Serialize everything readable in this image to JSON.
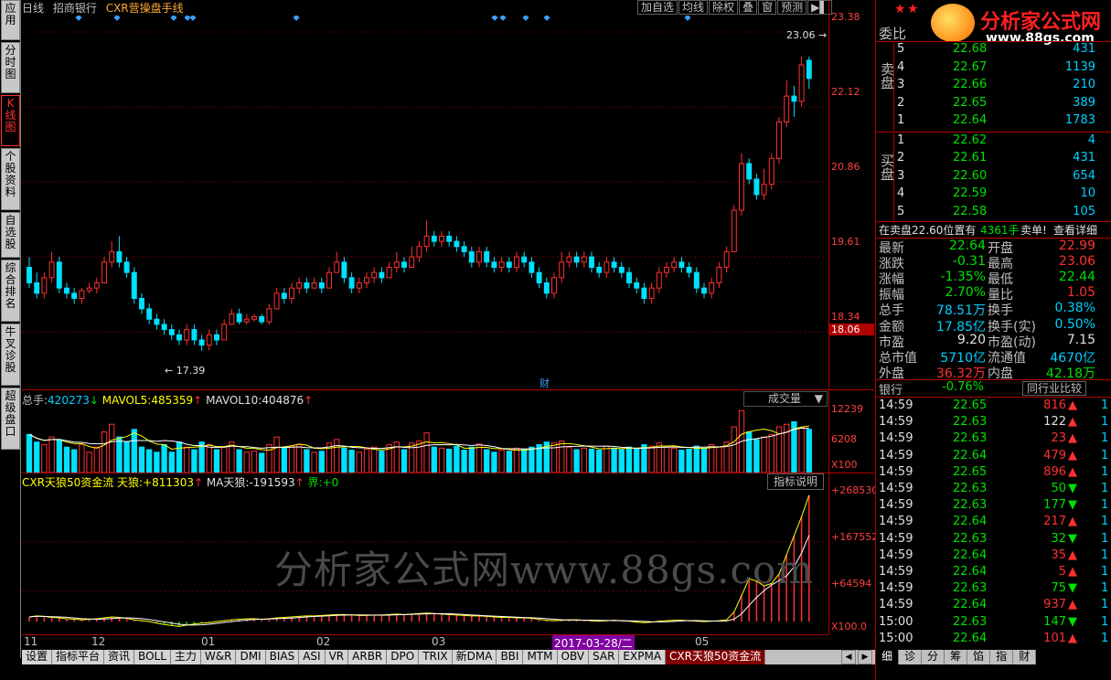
{
  "left_tabs": [
    {
      "label": "应用",
      "active": false
    },
    {
      "label": "分时图",
      "active": false
    },
    {
      "label": "K线图",
      "active": true
    },
    {
      "label": "个股资料",
      "active": false
    },
    {
      "label": "自选股",
      "active": false
    },
    {
      "label": "综合排名",
      "active": false
    },
    {
      "label": "牛叉诊股",
      "active": false
    },
    {
      "label": "超级盘口",
      "active": false
    }
  ],
  "header": {
    "period": "日线",
    "stock": "招商银行",
    "formula": "CXR营操盘手线"
  },
  "top_toolbar": [
    "加自选",
    "均线",
    "除权",
    "叠",
    "窗",
    "预测",
    "▶▌"
  ],
  "price_axis": {
    "labels": [
      "23.38",
      "22.12",
      "20.86",
      "19.61",
      "18.34"
    ],
    "current": "18.06"
  },
  "price_annotations": {
    "high": "23.06",
    "low": "17.39",
    "cai": "财"
  },
  "volume_panel": {
    "title": "总手:",
    "total": "420273",
    "total_arrow": "↓",
    "ma5_label": "MAVOL5:",
    "ma5": "485359",
    "ma5_arrow": "↑",
    "ma10_label": "MAVOL10:",
    "ma10": "404876",
    "ma10_arrow": "↑",
    "select": "成交量",
    "axis": [
      "12239",
      "6208",
      "X100"
    ]
  },
  "indicator_panel": {
    "name": "CXR天狼50资金流",
    "tl_label": "天狼:",
    "tl_value": "+811303",
    "tl_arrow": "↑",
    "ma_label": "MA天狼:",
    "ma_value": "-191593",
    "ma_arrow": "↑",
    "jie_label": "界:",
    "jie_value": "+0",
    "button": "指标说明",
    "axis": [
      "+268530",
      "+167552",
      "+64594",
      "X100.0"
    ]
  },
  "watermark": "分析家公式网www.88gs.com",
  "date_axis": [
    {
      "label": "11"
    },
    {
      "label": "12"
    },
    {
      "label": "01"
    },
    {
      "label": "02"
    },
    {
      "label": "03"
    },
    {
      "label": "2017-03-28/二",
      "highlight": true
    },
    {
      "label": "05"
    }
  ],
  "bottom_tabs": [
    "设置",
    "指标平台",
    "资讯",
    "BOLL",
    "主力",
    "W&R",
    "DMI",
    "BIAS",
    "ASI",
    "VR",
    "ARBR",
    "DPO",
    "TRIX",
    "新DMA",
    "BBI",
    "MTM",
    "OBV",
    "SAR",
    "EXPMA",
    "CXR天狼50资金流"
  ],
  "bottom_active": "CXR天狼50资金流",
  "logo": {
    "text": "分析家公式网",
    "url": "www.88gs.com"
  },
  "orderbook": {
    "title": "委比",
    "sell_side": "卖盘",
    "buy_side": "买盘",
    "asks": [
      {
        "lvl": "5",
        "price": "22.68",
        "vol": "431"
      },
      {
        "lvl": "4",
        "price": "22.67",
        "vol": "1139"
      },
      {
        "lvl": "3",
        "price": "22.66",
        "vol": "210"
      },
      {
        "lvl": "2",
        "price": "22.65",
        "vol": "389"
      },
      {
        "lvl": "1",
        "price": "22.64",
        "vol": "1783"
      }
    ],
    "bids": [
      {
        "lvl": "1",
        "price": "22.62",
        "vol": "4"
      },
      {
        "lvl": "2",
        "price": "22.61",
        "vol": "431"
      },
      {
        "lvl": "3",
        "price": "22.60",
        "vol": "654"
      },
      {
        "lvl": "4",
        "price": "22.59",
        "vol": "10"
      },
      {
        "lvl": "5",
        "price": "22.58",
        "vol": "105"
      }
    ],
    "note": "在卖盘22.60位置有",
    "note_vol": "4361手",
    "note_action": "卖单!",
    "note_link": "查看详细"
  },
  "quote": [
    {
      "l1": "最新",
      "v1": "22.64",
      "c1": "green",
      "l2": "开盘",
      "v2": "22.99",
      "c2": "red"
    },
    {
      "l1": "涨跌",
      "v1": "-0.31",
      "c1": "green",
      "l2": "最高",
      "v2": "23.06",
      "c2": "red"
    },
    {
      "l1": "涨幅",
      "v1": "-1.35%",
      "c1": "green",
      "l2": "最低",
      "v2": "22.44",
      "c2": "green"
    },
    {
      "l1": "振幅",
      "v1": "2.70%",
      "c1": "green",
      "l2": "量比",
      "v2": "1.05",
      "c2": "red"
    },
    {
      "l1": "总手",
      "v1": "78.51万",
      "c1": "cyan",
      "l2": "换手",
      "v2": "0.38%",
      "c2": "cyan"
    },
    {
      "l1": "金额",
      "v1": "17.85亿",
      "c1": "cyan",
      "l2": "换手(实)",
      "v2": "0.50%",
      "c2": "cyan"
    },
    {
      "l1": "市盈",
      "v1": "9.20",
      "c1": "white",
      "l2": "市盈(动)",
      "v2": "7.15",
      "c2": "white"
    },
    {
      "l1": "总市值",
      "v1": "5710亿",
      "c1": "cyan",
      "l2": "流通值",
      "v2": "4670亿",
      "c2": "cyan"
    },
    {
      "l1": "外盘",
      "v1": "36.32万",
      "c1": "red",
      "l2": "内盘",
      "v2": "42.18万",
      "c2": "green"
    }
  ],
  "sector": {
    "name": "银行",
    "change": "-0.76%",
    "button": "同行业比较"
  },
  "ticks": [
    {
      "t": "14:59",
      "p": "22.65",
      "v": "816",
      "d": "up",
      "pc": "green",
      "vc": "red",
      "n": "1"
    },
    {
      "t": "14:59",
      "p": "22.63",
      "v": "122",
      "d": "up",
      "pc": "green",
      "vc": "white",
      "n": "1"
    },
    {
      "t": "14:59",
      "p": "22.63",
      "v": "23",
      "d": "up",
      "pc": "green",
      "vc": "red",
      "n": "1"
    },
    {
      "t": "14:59",
      "p": "22.64",
      "v": "479",
      "d": "up",
      "pc": "green",
      "vc": "red",
      "n": "1"
    },
    {
      "t": "14:59",
      "p": "22.65",
      "v": "896",
      "d": "up",
      "pc": "green",
      "vc": "red",
      "n": "1"
    },
    {
      "t": "14:59",
      "p": "22.63",
      "v": "50",
      "d": "down",
      "pc": "green",
      "vc": "green",
      "n": "1"
    },
    {
      "t": "14:59",
      "p": "22.63",
      "v": "177",
      "d": "down",
      "pc": "green",
      "vc": "green",
      "n": "1"
    },
    {
      "t": "14:59",
      "p": "22.64",
      "v": "217",
      "d": "up",
      "pc": "green",
      "vc": "red",
      "n": "1"
    },
    {
      "t": "14:59",
      "p": "22.63",
      "v": "32",
      "d": "down",
      "pc": "green",
      "vc": "green",
      "n": "1"
    },
    {
      "t": "14:59",
      "p": "22.64",
      "v": "35",
      "d": "up",
      "pc": "green",
      "vc": "red",
      "n": "1"
    },
    {
      "t": "14:59",
      "p": "22.64",
      "v": "5",
      "d": "up",
      "pc": "green",
      "vc": "red",
      "n": "1"
    },
    {
      "t": "14:59",
      "p": "22.63",
      "v": "75",
      "d": "down",
      "pc": "green",
      "vc": "green",
      "n": "1"
    },
    {
      "t": "14:59",
      "p": "22.64",
      "v": "937",
      "d": "up",
      "pc": "green",
      "vc": "red",
      "n": "1"
    },
    {
      "t": "15:00",
      "p": "22.63",
      "v": "147",
      "d": "down",
      "pc": "green",
      "vc": "green",
      "n": "1"
    },
    {
      "t": "15:00",
      "p": "22.64",
      "v": "101",
      "d": "up",
      "pc": "green",
      "vc": "red",
      "n": "1"
    }
  ],
  "tick_tabs": [
    "细",
    "诊",
    "分",
    "筹",
    "馅",
    "指",
    "财"
  ],
  "tick_active": "细",
  "colors": {
    "up": "#ff3030",
    "down": "#00e0ff",
    "ma_white": "#ffffff",
    "ma_yellow": "#ffff00",
    "grid": "#b00000"
  },
  "chart_data": {
    "type": "candlestick",
    "candles": [
      [
        19.0,
        18.7,
        19.2,
        18.6
      ],
      [
        18.7,
        18.5,
        18.9,
        18.4
      ],
      [
        18.5,
        18.8,
        18.9,
        18.4
      ],
      [
        18.8,
        19.1,
        19.3,
        18.7
      ],
      [
        19.1,
        18.6,
        19.2,
        18.5
      ],
      [
        18.6,
        18.5,
        18.7,
        18.4
      ],
      [
        18.5,
        18.4,
        18.6,
        18.3
      ],
      [
        18.4,
        18.55,
        18.6,
        18.3
      ],
      [
        18.55,
        18.6,
        18.7,
        18.5
      ],
      [
        18.6,
        18.7,
        18.8,
        18.5
      ],
      [
        18.7,
        19.1,
        19.2,
        18.7
      ],
      [
        19.1,
        19.3,
        19.5,
        19.0
      ],
      [
        19.3,
        19.1,
        19.6,
        19.0
      ],
      [
        19.1,
        18.9,
        19.2,
        18.8
      ],
      [
        18.9,
        18.4,
        19.0,
        18.3
      ],
      [
        18.4,
        18.2,
        18.5,
        18.1
      ],
      [
        18.2,
        18.0,
        18.3,
        17.9
      ],
      [
        18.0,
        17.9,
        18.1,
        17.8
      ],
      [
        17.9,
        17.8,
        18.0,
        17.7
      ],
      [
        17.8,
        17.7,
        17.9,
        17.6
      ],
      [
        17.7,
        17.6,
        17.8,
        17.5
      ],
      [
        17.6,
        17.8,
        17.9,
        17.5
      ],
      [
        17.8,
        17.6,
        17.9,
        17.5
      ],
      [
        17.6,
        17.5,
        17.7,
        17.39
      ],
      [
        17.5,
        17.7,
        17.8,
        17.4
      ],
      [
        17.7,
        17.6,
        17.8,
        17.5
      ],
      [
        17.6,
        17.9,
        18.0,
        17.6
      ],
      [
        17.9,
        18.1,
        18.2,
        17.9
      ],
      [
        18.1,
        17.95,
        18.2,
        17.9
      ],
      [
        17.95,
        18.0,
        18.1,
        17.9
      ],
      [
        18.0,
        18.05,
        18.1,
        17.95
      ],
      [
        18.05,
        17.95,
        18.1,
        17.9
      ],
      [
        17.95,
        18.2,
        18.3,
        17.9
      ],
      [
        18.2,
        18.5,
        18.6,
        18.2
      ],
      [
        18.5,
        18.4,
        18.6,
        18.3
      ],
      [
        18.4,
        18.6,
        18.7,
        18.3
      ],
      [
        18.6,
        18.7,
        18.8,
        18.5
      ],
      [
        18.7,
        18.6,
        18.8,
        18.5
      ],
      [
        18.6,
        18.7,
        18.8,
        18.6
      ],
      [
        18.7,
        18.6,
        18.8,
        18.5
      ],
      [
        18.6,
        18.9,
        19.0,
        18.6
      ],
      [
        18.9,
        19.1,
        19.3,
        18.9
      ],
      [
        19.1,
        18.8,
        19.2,
        18.7
      ],
      [
        18.8,
        18.6,
        18.9,
        18.5
      ],
      [
        18.6,
        18.7,
        18.8,
        18.5
      ],
      [
        18.7,
        18.8,
        18.9,
        18.6
      ],
      [
        18.8,
        18.9,
        19.0,
        18.7
      ],
      [
        18.9,
        18.8,
        19.0,
        18.7
      ],
      [
        18.8,
        19.0,
        19.1,
        18.8
      ],
      [
        19.0,
        19.1,
        19.3,
        18.9
      ],
      [
        19.1,
        19.0,
        19.2,
        18.9
      ],
      [
        19.0,
        19.2,
        19.4,
        19.0
      ],
      [
        19.2,
        19.4,
        19.5,
        19.1
      ],
      [
        19.4,
        19.6,
        19.9,
        19.3
      ],
      [
        19.6,
        19.5,
        19.7,
        19.4
      ],
      [
        19.5,
        19.6,
        19.7,
        19.4
      ],
      [
        19.6,
        19.5,
        19.7,
        19.4
      ],
      [
        19.5,
        19.4,
        19.6,
        19.3
      ],
      [
        19.4,
        19.3,
        19.5,
        19.2
      ],
      [
        19.3,
        19.1,
        19.4,
        19.0
      ],
      [
        19.1,
        19.3,
        19.4,
        19.0
      ],
      [
        19.3,
        19.1,
        19.4,
        19.0
      ],
      [
        19.1,
        19.0,
        19.2,
        18.9
      ],
      [
        19.0,
        19.1,
        19.2,
        18.9
      ],
      [
        19.1,
        19.0,
        19.2,
        18.9
      ],
      [
        19.0,
        19.2,
        19.3,
        18.9
      ],
      [
        19.2,
        19.1,
        19.3,
        19.0
      ],
      [
        19.1,
        18.9,
        19.2,
        18.8
      ],
      [
        18.9,
        18.7,
        19.0,
        18.6
      ],
      [
        18.7,
        18.5,
        18.8,
        18.4
      ],
      [
        18.5,
        18.8,
        18.9,
        18.4
      ],
      [
        18.8,
        19.1,
        19.3,
        18.7
      ],
      [
        19.1,
        19.2,
        19.3,
        19.0
      ],
      [
        19.2,
        19.1,
        19.3,
        19.0
      ],
      [
        19.1,
        19.2,
        19.3,
        19.0
      ],
      [
        19.2,
        19.0,
        19.3,
        18.9
      ],
      [
        19.0,
        18.9,
        19.1,
        18.8
      ],
      [
        18.9,
        19.1,
        19.2,
        18.8
      ],
      [
        19.1,
        19.0,
        19.2,
        18.9
      ],
      [
        19.0,
        18.9,
        19.1,
        18.8
      ],
      [
        18.9,
        18.7,
        19.0,
        18.6
      ],
      [
        18.7,
        18.6,
        18.8,
        18.5
      ],
      [
        18.6,
        18.4,
        18.7,
        18.3
      ],
      [
        18.4,
        18.6,
        18.7,
        18.3
      ],
      [
        18.6,
        18.9,
        19.0,
        18.5
      ],
      [
        18.9,
        19.0,
        19.1,
        18.8
      ],
      [
        19.0,
        19.1,
        19.2,
        18.9
      ],
      [
        19.1,
        19.0,
        19.2,
        18.9
      ],
      [
        19.0,
        18.9,
        19.1,
        18.8
      ],
      [
        18.9,
        18.6,
        19.0,
        18.5
      ],
      [
        18.6,
        18.5,
        18.7,
        18.4
      ],
      [
        18.5,
        18.7,
        18.8,
        18.4
      ],
      [
        18.7,
        19.0,
        19.1,
        18.6
      ],
      [
        19.0,
        19.3,
        19.4,
        18.9
      ],
      [
        19.3,
        20.1,
        20.2,
        19.3
      ],
      [
        20.1,
        21.0,
        21.2,
        20.0
      ],
      [
        21.0,
        20.7,
        21.1,
        20.6
      ],
      [
        20.7,
        20.4,
        20.8,
        20.3
      ],
      [
        20.4,
        20.6,
        20.9,
        20.3
      ],
      [
        20.6,
        21.1,
        21.2,
        20.5
      ],
      [
        21.1,
        21.8,
        21.9,
        21.0
      ],
      [
        21.8,
        22.3,
        22.6,
        21.7
      ],
      [
        22.3,
        22.2,
        22.5,
        21.9
      ],
      [
        22.2,
        22.9,
        23.06,
        22.1
      ],
      [
        22.99,
        22.64,
        23.06,
        22.44
      ]
    ],
    "price_axis": [
      18.06,
      23.38
    ],
    "volume": [
      75,
      60,
      55,
      70,
      65,
      50,
      45,
      55,
      40,
      50,
      80,
      95,
      70,
      60,
      85,
      50,
      45,
      40,
      55,
      40,
      60,
      50,
      45,
      60,
      55,
      45,
      50,
      60,
      45,
      40,
      42,
      38,
      55,
      70,
      48,
      52,
      55,
      45,
      40,
      42,
      58,
      65,
      48,
      44,
      40,
      46,
      50,
      42,
      55,
      60,
      45,
      58,
      62,
      78,
      50,
      48,
      46,
      52,
      44,
      50,
      56,
      45,
      40,
      44,
      42,
      48,
      45,
      50,
      55,
      60,
      58,
      62,
      50,
      45,
      48,
      46,
      44,
      52,
      48,
      45,
      50,
      46,
      55,
      52,
      58,
      50,
      48,
      44,
      46,
      52,
      48,
      55,
      50,
      60,
      90,
      122,
      80,
      65,
      70,
      75,
      90,
      95,
      100,
      88,
      85
    ],
    "volume_range": [
      0,
      122.39
    ],
    "indicator": [
      10,
      12,
      11,
      9,
      8,
      6,
      5,
      4,
      5,
      6,
      8,
      10,
      9,
      7,
      4,
      2,
      0,
      -3,
      -6,
      -8,
      -10,
      -7,
      -5,
      -3,
      -2,
      0,
      2,
      4,
      5,
      6,
      6,
      5,
      6,
      8,
      9,
      10,
      11,
      12,
      12,
      13,
      14,
      15,
      15,
      14,
      13,
      13,
      14,
      14,
      15,
      16,
      15,
      16,
      17,
      18,
      17,
      16,
      15,
      14,
      13,
      12,
      12,
      11,
      10,
      9,
      9,
      8,
      8,
      7,
      5,
      3,
      2,
      3,
      4,
      4,
      3,
      2,
      1,
      2,
      3,
      2,
      1,
      -1,
      -2,
      -1,
      1,
      2,
      3,
      3,
      2,
      1,
      0,
      1,
      2,
      4,
      20,
      55,
      90,
      85,
      75,
      80,
      100,
      140,
      180,
      220,
      265
    ],
    "indicator_range": [
      -15,
      268.53
    ],
    "date_labels": [
      "11",
      "12",
      "01",
      "02",
      "03",
      "2017-03-28/二",
      "05"
    ]
  }
}
